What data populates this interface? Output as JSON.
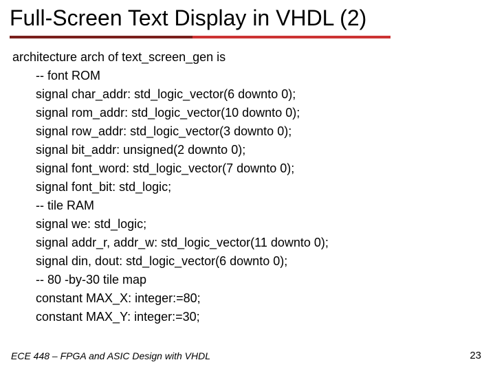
{
  "title": "Full-Screen Text Display in VHDL (2)",
  "code": {
    "l0": "architecture arch of text_screen_gen is",
    "l1": "-- font ROM",
    "l2": "signal char_addr: std_logic_vector(6 downto 0);",
    "l3": "signal rom_addr: std_logic_vector(10 downto 0);",
    "l4": "signal row_addr: std_logic_vector(3 downto 0);",
    "l5": "signal bit_addr: unsigned(2 downto 0);",
    "l6": "signal font_word: std_logic_vector(7 downto 0);",
    "l7": "signal font_bit: std_logic;",
    "l8": "-- tile RAM",
    "l9": "signal we: std_logic;",
    "l10": "signal addr_r, addr_w: std_logic_vector(11 downto 0);",
    "l11": "signal din, dout: std_logic_vector(6 downto 0);",
    "l12": "-- 80 -by-30 tile map",
    "l13": "constant MAX_X: integer:=80;",
    "l14": "constant MAX_Y: integer:=30;"
  },
  "footer": {
    "left": "ECE 448 – FPGA and ASIC Design with VHDL",
    "right": "23"
  }
}
